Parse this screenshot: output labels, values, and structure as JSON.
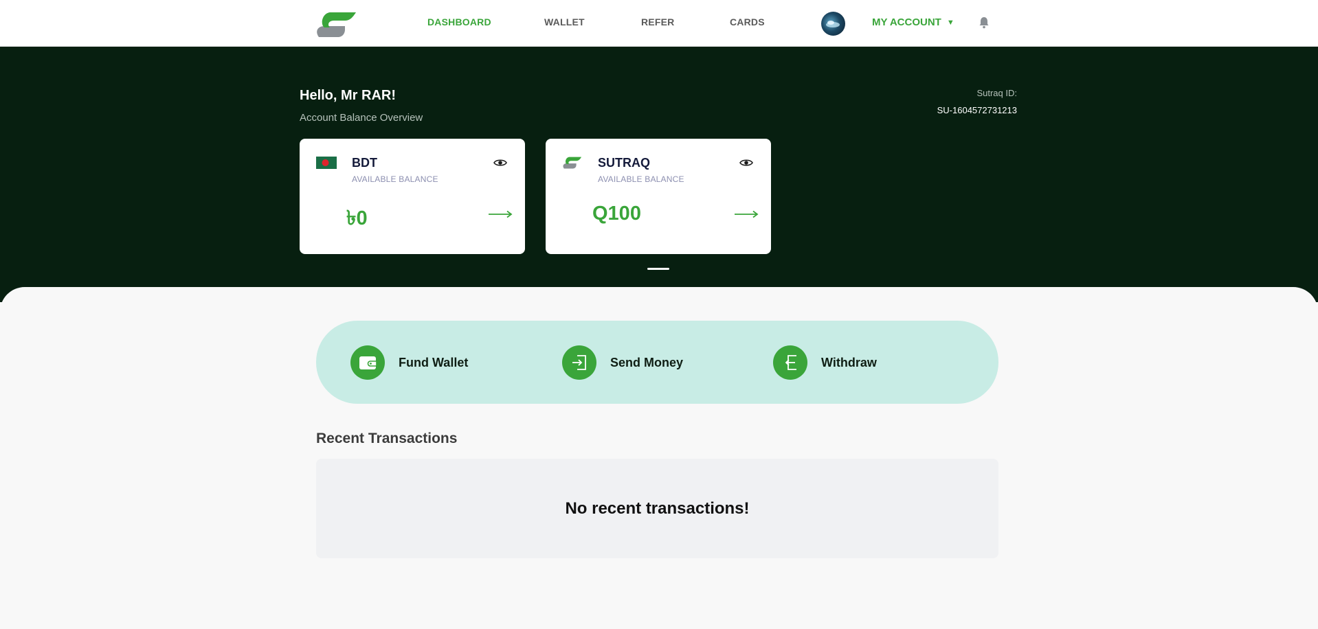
{
  "nav": {
    "links": [
      {
        "label": "DASHBOARD",
        "active": true
      },
      {
        "label": "WALLET",
        "active": false
      },
      {
        "label": "REFER",
        "active": false
      },
      {
        "label": "CARDS",
        "active": false
      }
    ],
    "account_label": "MY ACCOUNT",
    "caret": "▼",
    "logo_icon": "sutraq-logo-icon",
    "avatar_icon": "avatar",
    "bell_icon": "bell-icon"
  },
  "hero": {
    "greeting": "Hello, Mr RAR!",
    "subtitle": "Account Balance Overview",
    "sutraq_id_label": "Sutraq ID:",
    "sutraq_id_value": "SU-1604572731213"
  },
  "balances": [
    {
      "currency": "BDT",
      "sub": "AVAILABLE BALANCE",
      "amount": "৳0",
      "icon": "bangladesh-flag-icon"
    },
    {
      "currency": "SUTRAQ",
      "sub": "AVAILABLE BALANCE",
      "amount": "Q100",
      "icon": "sutraq-logo-icon"
    }
  ],
  "actions": [
    {
      "label": "Fund Wallet",
      "icon": "wallet-icon"
    },
    {
      "label": "Send Money",
      "icon": "send-icon"
    },
    {
      "label": "Withdraw",
      "icon": "withdraw-icon"
    }
  ],
  "recent": {
    "title": "Recent Transactions",
    "empty_message": "No recent transactions!"
  },
  "colors": {
    "brand_green": "#3aa53a",
    "hero_bg": "#071f10",
    "actions_bg": "#c8ece5",
    "page_bg": "#f8f8f8"
  }
}
